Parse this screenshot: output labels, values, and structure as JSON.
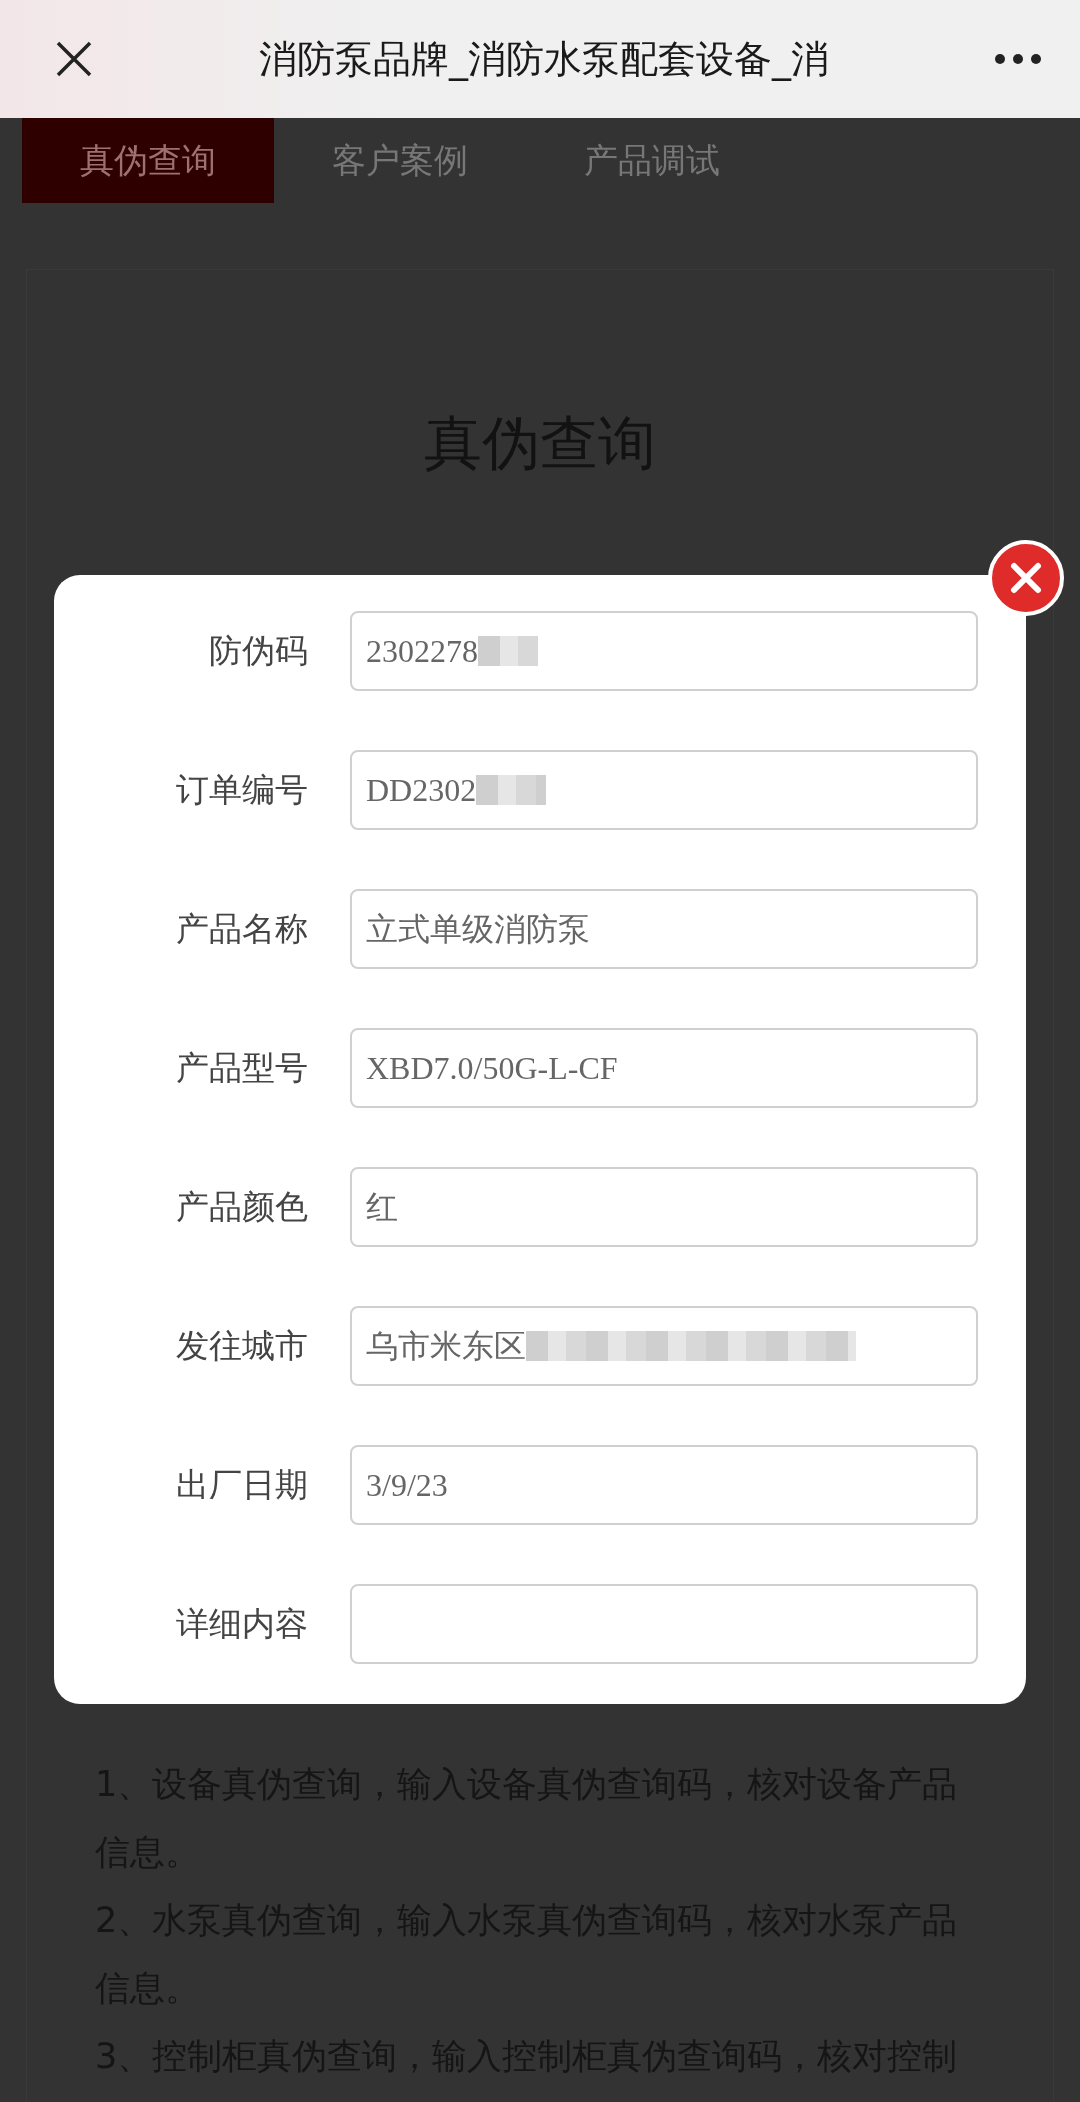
{
  "header": {
    "title": "消防泵品牌_消防水泵配套设备_消"
  },
  "tabs": [
    {
      "label": "真伪查询",
      "selected": true
    },
    {
      "label": "客户案例",
      "selected": false
    },
    {
      "label": "产品调试",
      "selected": false
    }
  ],
  "heading": "真伪查询",
  "dialog": {
    "fields": [
      {
        "label": "防伪码",
        "value": "2302278",
        "redacted": true
      },
      {
        "label": "订单编号",
        "value": "DD2302",
        "redacted": true
      },
      {
        "label": "产品名称",
        "value": "立式单级消防泵",
        "redacted": false
      },
      {
        "label": "产品型号",
        "value": "XBD7.0/50G-L-CF",
        "redacted": false
      },
      {
        "label": "产品颜色",
        "value": "红",
        "redacted": false
      },
      {
        "label": "发往城市",
        "value": "乌市米东区",
        "redacted": true
      },
      {
        "label": "出厂日期",
        "value": "3/9/23",
        "redacted": false
      },
      {
        "label": "详细内容",
        "redacted": false
      }
    ]
  },
  "notes": [
    "1、设备真伪查询，输入设备真伪查询码，核对设备产品信息。",
    "2、水泵真伪查询，输入水泵真伪查询码，核对水泵产品信息。",
    "3、控制柜真伪查询，输入控制柜真伪查询码，核对控制"
  ]
}
